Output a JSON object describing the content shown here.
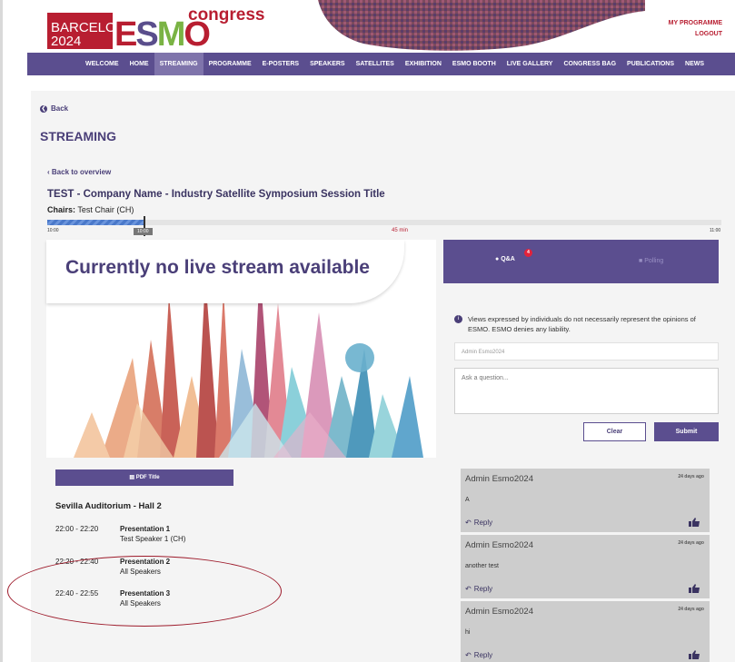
{
  "header": {
    "logo_city": "BARCELONA",
    "logo_year": "2024",
    "logo_esmo": [
      "E",
      "S",
      "M",
      "O"
    ],
    "logo_congress": "congress",
    "links": [
      "MY PROGRAMME",
      "LOGOUT"
    ]
  },
  "nav": {
    "items": [
      "WELCOME",
      "HOME",
      "STREAMING",
      "PROGRAMME",
      "E-POSTERS",
      "SPEAKERS",
      "SATELLITES",
      "EXHIBITION",
      "ESMO BOOTH",
      "LIVE GALLERY",
      "CONGRESS BAG",
      "PUBLICATIONS",
      "NEWS"
    ],
    "active": "STREAMING"
  },
  "page": {
    "back": "Back",
    "title": "STREAMING",
    "back_overview": "Back to overview",
    "session_title": "TEST - Company Name - Industry Satellite Symposium Session Title",
    "chairs_label": "Chairs:",
    "chairs_value": "Test Chair (CH)"
  },
  "timeline": {
    "start": "10:00",
    "now": "10:00",
    "remaining": "45 min",
    "end": "11:00",
    "progress": 0.145
  },
  "video": {
    "message": "Currently no live stream available"
  },
  "pdf_button": "PDF Title",
  "agenda": {
    "hall": "Sevilla Auditorium - Hall 2",
    "items": [
      {
        "time": "22:00 - 22:20",
        "title": "Presentation 1",
        "speaker": "Test Speaker 1 (CH)"
      },
      {
        "time": "22:20 - 22:40",
        "title": "Presentation 2",
        "speaker": "All Speakers"
      },
      {
        "time": "22:40 - 22:55",
        "title": "Presentation 3",
        "speaker": "All Speakers"
      }
    ]
  },
  "qa": {
    "tab_qa": "Q&A",
    "badge": "4",
    "tab_polling": "Polling",
    "disclaimer": "Views expressed by individuals do not necessarily represent the opinions of ESMO. ESMO denies any liability.",
    "user": "Admin Esmo2024",
    "question_placeholder": "Ask a question...",
    "clear": "Clear",
    "submit": "Submit",
    "reply": "Reply",
    "comments": [
      {
        "author": "Admin Esmo2024",
        "date": "24 days ago",
        "text": "A"
      },
      {
        "author": "Admin Esmo2024",
        "date": "24 days ago",
        "text": "another test"
      },
      {
        "author": "Admin Esmo2024",
        "date": "24 days ago",
        "text": "hi"
      }
    ]
  },
  "colors": {
    "brand_purple": "#5b4e8f",
    "brand_red": "#b81e31",
    "brand_green": "#7ab344",
    "badge_red": "#e2223b",
    "annotation_circle": "#9d1a2a"
  }
}
